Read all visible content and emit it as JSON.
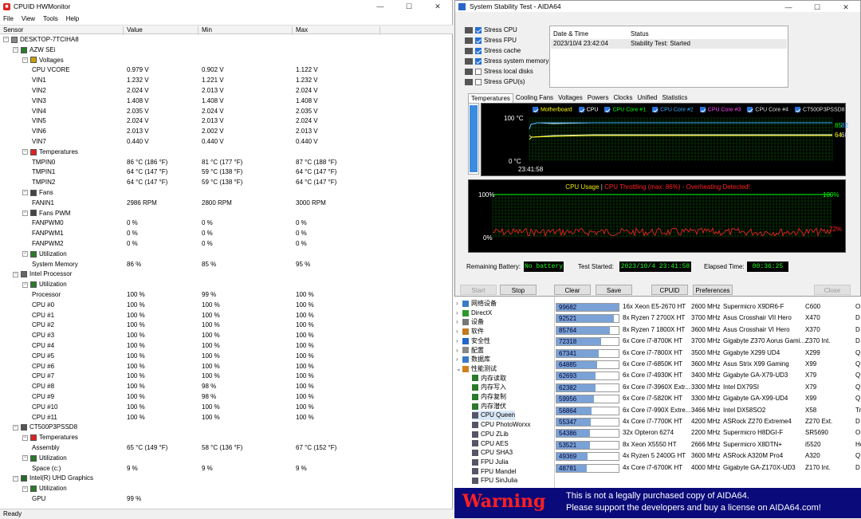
{
  "hw": {
    "title": "CPUID HWMonitor",
    "menu": [
      "File",
      "View",
      "Tools",
      "Help"
    ],
    "cols": [
      "Sensor",
      "Value",
      "Min",
      "Max"
    ],
    "status": "Ready",
    "rows": [
      {
        "n": "DESKTOP-7TCIHA8",
        "lvl": 0,
        "icon": "computer-icon"
      },
      {
        "n": "AZW SEi",
        "lvl": 1,
        "icon": "motherboard-icon"
      },
      {
        "n": "Voltages",
        "lvl": 2,
        "icon": "voltage-icon"
      },
      {
        "n": "CPU VCORE",
        "lvl": 3,
        "v": "0.979 V",
        "mn": "0.902 V",
        "mx": "1.122 V"
      },
      {
        "n": "VIN1",
        "lvl": 3,
        "v": "1.232 V",
        "mn": "1.221 V",
        "mx": "1.232 V"
      },
      {
        "n": "VIN2",
        "lvl": 3,
        "v": "2.024 V",
        "mn": "2.013 V",
        "mx": "2.024 V"
      },
      {
        "n": "VIN3",
        "lvl": 3,
        "v": "1.408 V",
        "mn": "1.408 V",
        "mx": "1.408 V"
      },
      {
        "n": "VIN4",
        "lvl": 3,
        "v": "2.035 V",
        "mn": "2.024 V",
        "mx": "2.035 V"
      },
      {
        "n": "VIN5",
        "lvl": 3,
        "v": "2.024 V",
        "mn": "2.013 V",
        "mx": "2.024 V"
      },
      {
        "n": "VIN6",
        "lvl": 3,
        "v": "2.013 V",
        "mn": "2.002 V",
        "mx": "2.013 V"
      },
      {
        "n": "VIN7",
        "lvl": 3,
        "v": "0.440 V",
        "mn": "0.440 V",
        "mx": "0.440 V"
      },
      {
        "n": "Temperatures",
        "lvl": 2,
        "icon": "thermometer-icon"
      },
      {
        "n": "TMPIN0",
        "lvl": 3,
        "v": "86 °C  (186 °F)",
        "mn": "81 °C  (177 °F)",
        "mx": "87 °C  (188 °F)"
      },
      {
        "n": "TMPIN1",
        "lvl": 3,
        "v": "64 °C  (147 °F)",
        "mn": "59 °C  (138 °F)",
        "mx": "64 °C  (147 °F)"
      },
      {
        "n": "TMPIN2",
        "lvl": 3,
        "v": "64 °C  (147 °F)",
        "mn": "59 °C  (138 °F)",
        "mx": "64 °C  (147 °F)"
      },
      {
        "n": "Fans",
        "lvl": 2,
        "icon": "fan-icon"
      },
      {
        "n": "FANIN1",
        "lvl": 3,
        "v": "2986 RPM",
        "mn": "2800 RPM",
        "mx": "3000 RPM"
      },
      {
        "n": "Fans PWM",
        "lvl": 2,
        "icon": "fan-icon"
      },
      {
        "n": "FANPWM0",
        "lvl": 3,
        "v": "0 %",
        "mn": "0 %",
        "mx": "0 %"
      },
      {
        "n": "FANPWM1",
        "lvl": 3,
        "v": "0 %",
        "mn": "0 %",
        "mx": "0 %"
      },
      {
        "n": "FANPWM2",
        "lvl": 3,
        "v": "0 %",
        "mn": "0 %",
        "mx": "0 %"
      },
      {
        "n": "Utilization",
        "lvl": 2,
        "icon": "utilization-icon"
      },
      {
        "n": "System Memory",
        "lvl": 3,
        "v": "86 %",
        "mn": "85 %",
        "mx": "95 %"
      },
      {
        "n": "Intel Processor",
        "lvl": 1,
        "icon": "cpu-icon"
      },
      {
        "n": "Utilization",
        "lvl": 2,
        "icon": "utilization-icon"
      },
      {
        "n": "Processor",
        "lvl": 3,
        "v": "100 %",
        "mn": "99 %",
        "mx": "100 %"
      },
      {
        "n": "CPU #0",
        "lvl": 3,
        "v": "100 %",
        "mn": "100 %",
        "mx": "100 %"
      },
      {
        "n": "CPU #1",
        "lvl": 3,
        "v": "100 %",
        "mn": "100 %",
        "mx": "100 %"
      },
      {
        "n": "CPU #2",
        "lvl": 3,
        "v": "100 %",
        "mn": "100 %",
        "mx": "100 %"
      },
      {
        "n": "CPU #3",
        "lvl": 3,
        "v": "100 %",
        "mn": "100 %",
        "mx": "100 %"
      },
      {
        "n": "CPU #4",
        "lvl": 3,
        "v": "100 %",
        "mn": "100 %",
        "mx": "100 %"
      },
      {
        "n": "CPU #5",
        "lvl": 3,
        "v": "100 %",
        "mn": "100 %",
        "mx": "100 %"
      },
      {
        "n": "CPU #6",
        "lvl": 3,
        "v": "100 %",
        "mn": "100 %",
        "mx": "100 %"
      },
      {
        "n": "CPU #7",
        "lvl": 3,
        "v": "100 %",
        "mn": "100 %",
        "mx": "100 %"
      },
      {
        "n": "CPU #8",
        "lvl": 3,
        "v": "100 %",
        "mn": "98 %",
        "mx": "100 %"
      },
      {
        "n": "CPU #9",
        "lvl": 3,
        "v": "100 %",
        "mn": "98 %",
        "mx": "100 %"
      },
      {
        "n": "CPU #10",
        "lvl": 3,
        "v": "100 %",
        "mn": "100 %",
        "mx": "100 %"
      },
      {
        "n": "CPU #11",
        "lvl": 3,
        "v": "100 %",
        "mn": "100 %",
        "mx": "100 %"
      },
      {
        "n": "CT500P3PSSD8",
        "lvl": 1,
        "icon": "disk-icon"
      },
      {
        "n": "Temperatures",
        "lvl": 2,
        "icon": "thermometer-icon"
      },
      {
        "n": "Assembly",
        "lvl": 3,
        "v": "65 °C  (149 °F)",
        "mn": "58 °C  (136 °F)",
        "mx": "67 °C  (152 °F)"
      },
      {
        "n": "Utilization",
        "lvl": 2,
        "icon": "utilization-icon"
      },
      {
        "n": "Space (c:)",
        "lvl": 3,
        "v": "9 %",
        "mn": "9 %",
        "mx": "9 %"
      },
      {
        "n": "Intel(R) UHD Graphics",
        "lvl": 1,
        "icon": "gpu-icon"
      },
      {
        "n": "Utilization",
        "lvl": 2,
        "icon": "utilization-icon"
      },
      {
        "n": "GPU",
        "lvl": 3,
        "v": "99 %",
        "mn": "",
        "mx": ""
      }
    ]
  },
  "aida": {
    "tree": [
      {
        "n": "网络设备",
        "lvl": 0,
        "icon": "network-icon"
      },
      {
        "n": "DirectX",
        "lvl": 0,
        "icon": "directx-icon"
      },
      {
        "n": "设备",
        "lvl": 0,
        "icon": "devices-icon"
      },
      {
        "n": "软件",
        "lvl": 0,
        "icon": "software-icon"
      },
      {
        "n": "安全性",
        "lvl": 0,
        "icon": "security-icon"
      },
      {
        "n": "配置",
        "lvl": 0,
        "icon": "config-icon"
      },
      {
        "n": "数据库",
        "lvl": 0,
        "icon": "database-icon"
      },
      {
        "n": "性能测试",
        "lvl": 0,
        "icon": "benchmark-icon",
        "open": true
      },
      {
        "n": "内存读取",
        "lvl": 1,
        "icon": "memory-icon"
      },
      {
        "n": "内存写入",
        "lvl": 1,
        "icon": "memory-icon"
      },
      {
        "n": "内存复制",
        "lvl": 1,
        "icon": "memory-icon"
      },
      {
        "n": "内存潜伏",
        "lvl": 1,
        "icon": "memory-icon"
      },
      {
        "n": "CPU Queen",
        "lvl": 1,
        "icon": "cpu-icon",
        "sel": true
      },
      {
        "n": "CPU PhotoWorxx",
        "lvl": 1,
        "icon": "cpu-icon"
      },
      {
        "n": "CPU ZLib",
        "lvl": 1,
        "icon": "cpu-icon"
      },
      {
        "n": "CPU AES",
        "lvl": 1,
        "icon": "cpu-icon"
      },
      {
        "n": "CPU SHA3",
        "lvl": 1,
        "icon": "cpu-icon"
      },
      {
        "n": "FPU Julia",
        "lvl": 1,
        "icon": "fpu-icon"
      },
      {
        "n": "FPU Mandel",
        "lvl": 1,
        "icon": "fpu-icon"
      },
      {
        "n": "FPU SinJulia",
        "lvl": 1,
        "icon": "fpu-icon"
      }
    ],
    "bench_max": 100000,
    "bench": [
      {
        "score": "99682",
        "v": 99682,
        "cpu": "16x Xeon E5-2670 HT",
        "clk": "2600 MHz",
        "mb": "Supermicro X9DR6-F",
        "chip": "C600",
        "ext": "O"
      },
      {
        "score": "92521",
        "v": 92521,
        "cpu": "8x Ryzen 7 2700X HT",
        "clk": "3700 MHz",
        "mb": "Asus Crosshair VII Hero",
        "chip": "X470",
        "ext": "D"
      },
      {
        "score": "85764",
        "v": 85764,
        "cpu": "8x Ryzen 7 1800X HT",
        "clk": "3600 MHz",
        "mb": "Asus Crosshair VI Hero",
        "chip": "X370",
        "ext": "D"
      },
      {
        "score": "72318",
        "v": 72318,
        "cpu": "6x Core i7-8700K HT",
        "clk": "3700 MHz",
        "mb": "Gigabyte Z370 Aorus Gami...",
        "chip": "Z370 Int.",
        "ext": "D"
      },
      {
        "score": "67341",
        "v": 67341,
        "cpu": "6x Core i7-7800X HT",
        "clk": "3500 MHz",
        "mb": "Gigabyte X299 UD4",
        "chip": "X299",
        "ext": "Q"
      },
      {
        "score": "64885",
        "v": 64885,
        "cpu": "6x Core i7-6850K HT",
        "clk": "3600 MHz",
        "mb": "Asus Strix X99 Gaming",
        "chip": "X99",
        "ext": "Q"
      },
      {
        "score": "62693",
        "v": 62693,
        "cpu": "6x Core i7-4930K HT",
        "clk": "3400 MHz",
        "mb": "Gigabyte GA-X79-UD3",
        "chip": "X79",
        "ext": "Q"
      },
      {
        "score": "62382",
        "v": 62382,
        "cpu": "6x Core i7-3960X Extr...",
        "clk": "3300 MHz",
        "mb": "Intel DX79SI",
        "chip": "X79",
        "ext": "Q"
      },
      {
        "score": "59956",
        "v": 59956,
        "cpu": "6x Core i7-5820K HT",
        "clk": "3300 MHz",
        "mb": "Gigabyte GA-X99-UD4",
        "chip": "X99",
        "ext": "Q"
      },
      {
        "score": "56864",
        "v": 56864,
        "cpu": "6x Core i7-990X Extre...",
        "clk": "3466 MHz",
        "mb": "Intel DX58SO2",
        "chip": "X58",
        "ext": "Tr"
      },
      {
        "score": "55347",
        "v": 55347,
        "cpu": "4x Core i7-7700K HT",
        "clk": "4200 MHz",
        "mb": "ASRock Z270 Extreme4",
        "chip": "Z270 Ext.",
        "ext": "D"
      },
      {
        "score": "54386",
        "v": 54386,
        "cpu": "32x Opteron 6274",
        "clk": "2200 MHz",
        "mb": "Supermicro H8DGI-F",
        "chip": "SR5690",
        "ext": "O"
      },
      {
        "score": "53521",
        "v": 53521,
        "cpu": "8x Xeon X5550 HT",
        "clk": "2666 MHz",
        "mb": "Supermicro X8DTN+",
        "chip": "i5520",
        "ext": "He"
      },
      {
        "score": "49369",
        "v": 49369,
        "cpu": "4x Ryzen 5 2400G HT",
        "clk": "3600 MHz",
        "mb": "ASRock A320M Pro4",
        "chip": "A320",
        "ext": "Q"
      },
      {
        "score": "48781",
        "v": 48781,
        "cpu": "4x Core i7-6700K HT",
        "clk": "4000 MHz",
        "mb": "Gigabyte GA-Z170X-UD3",
        "chip": "Z170 Int.",
        "ext": "D"
      }
    ]
  },
  "dlg": {
    "title": "System Stability Test - AIDA64",
    "stress": [
      {
        "label": "Stress CPU",
        "on": true,
        "icon": "cpu-icon"
      },
      {
        "label": "Stress FPU",
        "on": true,
        "icon": "fpu-icon"
      },
      {
        "label": "Stress cache",
        "on": true,
        "icon": "cache-icon"
      },
      {
        "label": "Stress system memory",
        "on": true,
        "icon": "memory-icon"
      },
      {
        "label": "Stress local disks",
        "on": false,
        "icon": "disk-icon"
      },
      {
        "label": "Stress GPU(s)",
        "on": false,
        "icon": "gpu-icon"
      }
    ],
    "log_cols": [
      "Date & Time",
      "Status"
    ],
    "log": [
      {
        "t": "2023/10/4 23:42:04",
        "s": "Stability Test: Started"
      }
    ],
    "tabs": [
      "Temperatures",
      "Cooling Fans",
      "Voltages",
      "Powers",
      "Clocks",
      "Unified",
      "Statistics"
    ],
    "legend": [
      {
        "label": "Motherboard",
        "color": "#ffff00"
      },
      {
        "label": "CPU",
        "color": "#ffffff"
      },
      {
        "label": "CPU Core #1",
        "color": "#00ff00"
      },
      {
        "label": "CPU Core #2",
        "color": "#33aaff"
      },
      {
        "label": "CPU Core #3",
        "color": "#ff44ff"
      },
      {
        "label": "CPU Core #4",
        "color": "#dddddd"
      },
      {
        "label": "CT500P3PSSD8",
        "color": "#dddddd"
      }
    ],
    "temp": {
      "top": "100 °C",
      "bottom": "0 °C",
      "time": "23:41:58",
      "r1a": "85",
      "r1b": "82",
      "r2a": "64",
      "r2b": "68"
    },
    "usage": {
      "title1": "CPU Usage",
      "sep": "|",
      "title2": "CPU Throttling (max: 86%) - Overheating Detected!",
      "top_l": "100%",
      "bot_l": "0%",
      "top_r": "100%",
      "mid_r": "22%"
    },
    "battery_label": "Remaining Battery:",
    "battery": "No battery",
    "started_label": "Test Started:",
    "started": "2023/10/4 23:41:58",
    "elapsed_label": "Elapsed Time:",
    "elapsed": "00:36:25",
    "buttons": {
      "start": "Start",
      "stop": "Stop",
      "clear": "Clear",
      "save": "Save",
      "cpuid": "CPUID",
      "prefs": "Preferences",
      "close": "Close"
    }
  },
  "warn": {
    "big": "Warning",
    "line1": "This is not a legally purchased copy of AIDA64.",
    "line2": "Please support the developers and buy a license on AIDA64.com!"
  },
  "colors": {
    "graph_grid": "#0a4a0a",
    "usage_line": "#00ff00",
    "throttle_line": "#ff2222",
    "warn_bg": "#0a0a7a",
    "warn_red": "#ff2020"
  }
}
